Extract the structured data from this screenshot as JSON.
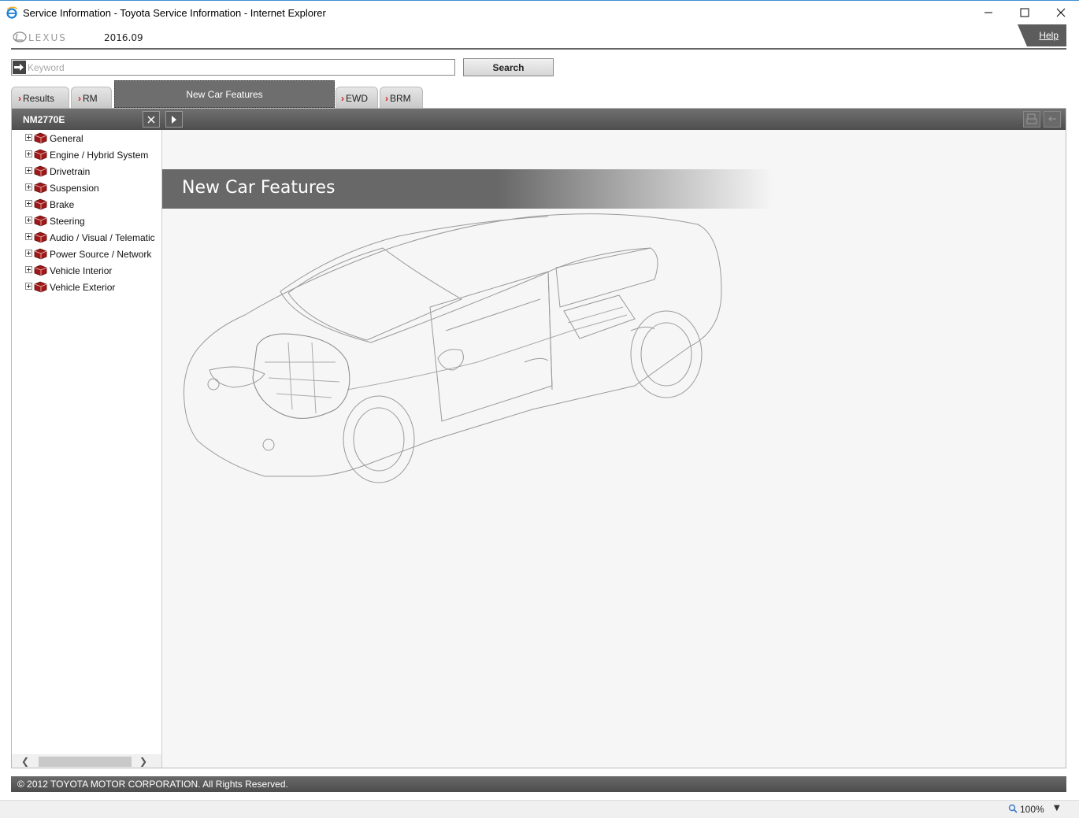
{
  "window": {
    "title": "Service Information - Toyota Service Information - Internet Explorer",
    "icon": "ie-icon"
  },
  "header": {
    "logo_text": "LEXUS",
    "version": "2016.09",
    "help_label": "Help"
  },
  "search": {
    "placeholder": "Keyword",
    "value": "",
    "button_label": "Search"
  },
  "tabs": [
    {
      "label": "Results",
      "active": false
    },
    {
      "label": "RM",
      "active": false
    },
    {
      "label": "New Car Features",
      "active": true
    },
    {
      "label": "EWD",
      "active": false
    },
    {
      "label": "BRM",
      "active": false
    }
  ],
  "panel": {
    "document_id": "NM2770E"
  },
  "tree": [
    {
      "label": "General"
    },
    {
      "label": "Engine / Hybrid System"
    },
    {
      "label": "Drivetrain"
    },
    {
      "label": "Suspension"
    },
    {
      "label": "Brake"
    },
    {
      "label": "Steering"
    },
    {
      "label": "Audio / Visual / Telematic"
    },
    {
      "label": "Power Source / Network"
    },
    {
      "label": "Vehicle Interior"
    },
    {
      "label": "Vehicle Exterior"
    }
  ],
  "content": {
    "banner_title": "New Car Features"
  },
  "footer": {
    "copyright": "© 2012 TOYOTA MOTOR CORPORATION. All Rights Reserved."
  },
  "statusbar": {
    "zoom": "100%"
  },
  "colors": {
    "accent_red": "#d42020",
    "bar_gray": "#5c5c5c",
    "panel_bg": "#f5f6f5"
  }
}
